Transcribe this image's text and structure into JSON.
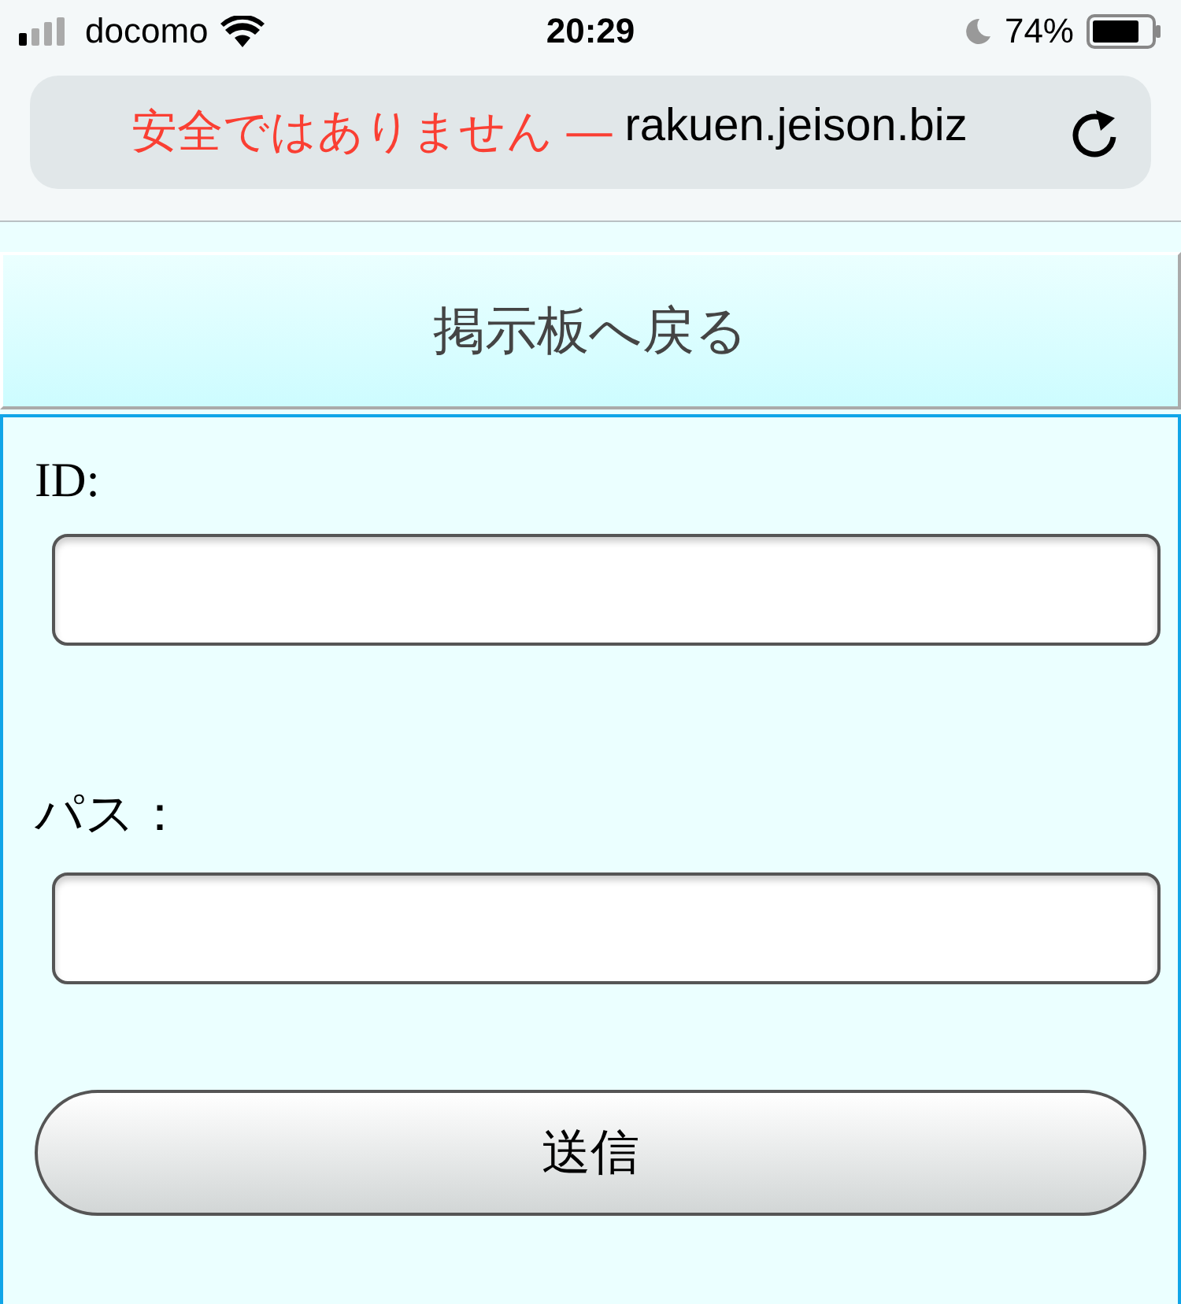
{
  "status_bar": {
    "carrier": "docomo",
    "time": "20:29",
    "battery": "74%"
  },
  "address_bar": {
    "warning": "安全ではありません —",
    "domain": "rakuen.jeison.biz"
  },
  "back_link": {
    "label": "掲示板へ戻る"
  },
  "form": {
    "fields": [
      {
        "label": "ID:"
      },
      {
        "label": "パス："
      }
    ],
    "submit": "送信"
  }
}
